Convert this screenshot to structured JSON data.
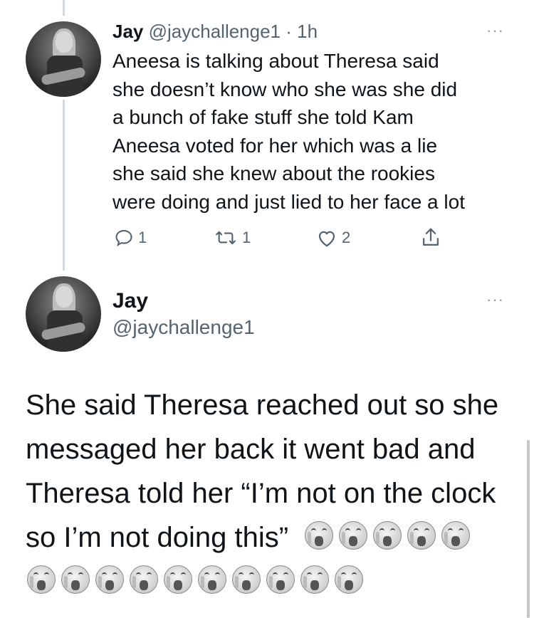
{
  "tweet1": {
    "name": "Jay",
    "meta": " @jaychallenge1 · 1h",
    "more": "···",
    "lines": [
      "Aneesa is talking about Theresa said",
      "she doesn’t know who she was she did",
      "a bunch of fake stuff she told Kam",
      "Aneesa voted for her which was a lie",
      "she said she knew about the rookies",
      "were doing and just lied to her face a lot"
    ],
    "reply_count": "1",
    "retweet_count": "1",
    "like_count": "2"
  },
  "tweet2": {
    "name": "Jay",
    "handle": "@jaychallenge1",
    "more": "···",
    "lines": [
      "She said Theresa reached out so she",
      "messaged her back it went bad and",
      "Theresa told her “I’m not on the clock",
      "so I’m not doing this”"
    ],
    "emoji_icon": "loudly-crying-face-emoji",
    "emoji_row1_count": 5,
    "emoji_row2_count": 10
  }
}
